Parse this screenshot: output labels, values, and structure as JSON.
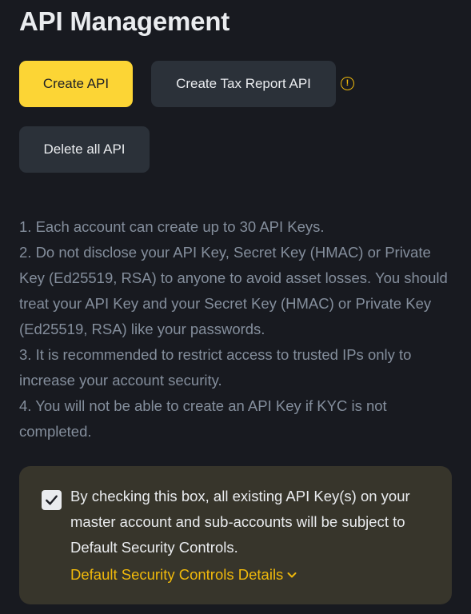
{
  "page": {
    "title": "API Management"
  },
  "buttons": {
    "create_api": "Create API",
    "create_tax_report_api": "Create Tax Report API",
    "delete_all_api": "Delete all API"
  },
  "info_icon_glyph": "!",
  "notes": [
    "1. Each account can create up to 30 API Keys.",
    "2. Do not disclose your API Key, Secret Key (HMAC) or Private Key (Ed25519, RSA) to anyone to avoid asset losses. You should treat your API Key and your Secret Key (HMAC) or Private Key (Ed25519, RSA) like your passwords.",
    "3. It is recommended to restrict access to trusted IPs only to increase your account security.",
    "4. You will not be able to create an API Key if KYC is not completed."
  ],
  "security_panel": {
    "checked": true,
    "text": "By checking this box, all existing API Key(s) on your master account and sub-accounts will be subject to Default Security Controls.",
    "link_label": "Default Security Controls Details"
  },
  "colors": {
    "background": "#181a20",
    "primary": "#fcd535",
    "secondary_button": "#2b3139",
    "accent": "#f0b90b",
    "muted_text": "#848e9c",
    "panel": "#37352b"
  },
  "icons": {
    "info": "info-circle-icon",
    "check": "checkmark-icon",
    "chevron": "chevron-down-icon"
  }
}
